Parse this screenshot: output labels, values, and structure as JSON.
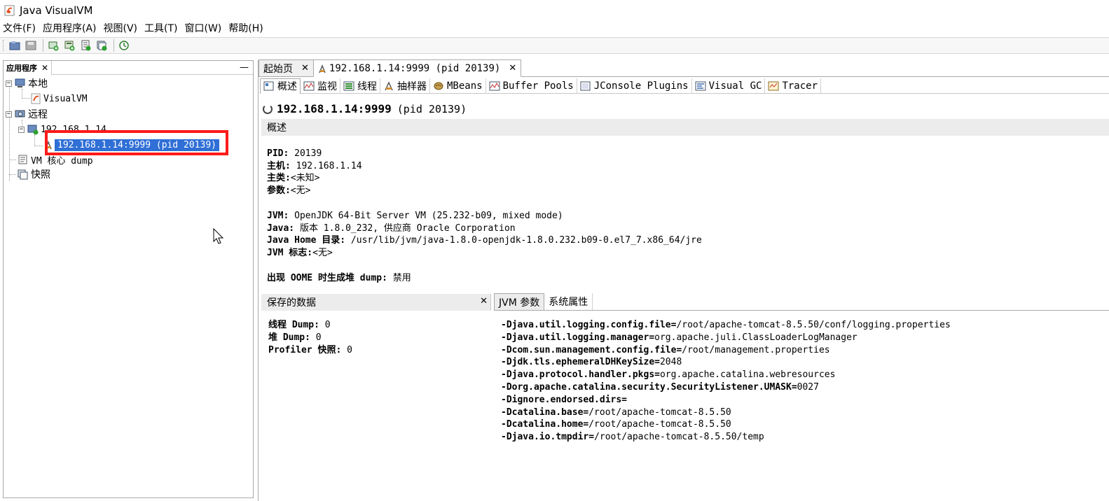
{
  "window": {
    "title": "Java VisualVM"
  },
  "menu": [
    "文件(F)",
    "应用程序(A)",
    "视图(V)",
    "工具(T)",
    "窗口(W)",
    "帮助(H)"
  ],
  "toolbar": {
    "icons": [
      "open-icon",
      "save-icon",
      "add-jmx-connection-icon",
      "add-remote-host-icon",
      "add-vm-coredump-icon",
      "add-snapshot-icon",
      "compare-icon"
    ]
  },
  "left_pane": {
    "tab_label": "应用程序",
    "tree": {
      "local": "本地",
      "visualvm": "VisualVM",
      "remote": "远程",
      "remote_host": "192.168.1.14",
      "remote_app": "192.168.1.14:9999 (pid 20139)",
      "coredump": "VM 核心 dump",
      "snapshot": "快照"
    }
  },
  "doc_tabs": [
    {
      "label": "起始页",
      "active": false
    },
    {
      "label": "192.168.1.14:9999 (pid 20139)",
      "active": true
    }
  ],
  "view_tabs": [
    {
      "label": "概述",
      "icon": "overview-icon",
      "active": true
    },
    {
      "label": "监视",
      "icon": "monitor-icon"
    },
    {
      "label": "线程",
      "icon": "threads-icon"
    },
    {
      "label": "抽样器",
      "icon": "sampler-icon"
    },
    {
      "label": "MBeans",
      "icon": "mbeans-icon"
    },
    {
      "label": "Buffer Pools",
      "icon": "buffer-pools-icon"
    },
    {
      "label": "JConsole Plugins",
      "icon": "jconsole-icon"
    },
    {
      "label": "Visual GC",
      "icon": "visual-gc-icon"
    },
    {
      "label": "Tracer",
      "icon": "tracer-icon"
    }
  ],
  "overview": {
    "host": "192.168.1.14:9999",
    "pid": "(pid 20139)",
    "section": "概述",
    "pid_label": "PID:",
    "pid_value": "20139",
    "host_label": "主机:",
    "host_value": "192.168.1.14",
    "mainclass_label": "主类:",
    "mainclass_value": "<未知>",
    "args_label": "参数:",
    "args_value": "<无>",
    "jvm_label": "JVM:",
    "jvm_value": "OpenJDK 64-Bit Server VM (25.232-b09, mixed mode)",
    "java_label": "Java:",
    "java_value": "版本 1.8.0_232, 供应商 Oracle Corporation",
    "javahome_label": "Java Home 目录:",
    "javahome_value": "/usr/lib/jvm/java-1.8.0-openjdk-1.8.0.232.b09-0.el7_7.x86_64/jre",
    "jvmflags_label": "JVM 标志:",
    "jvmflags_value": "<无>",
    "oome_label": "出现 OOME 时生成堆 dump:",
    "oome_value": "禁用"
  },
  "saved_data": {
    "title": "保存的数据",
    "thread_label": "线程 Dump:",
    "thread_value": "0",
    "heap_label": "堆 Dump:",
    "heap_value": "0",
    "profiler_label": "Profiler 快照:",
    "profiler_value": "0"
  },
  "jvm_tabs": {
    "args": "JVM 参数",
    "props": "系统属性"
  },
  "jvm_args": [
    {
      "key": "-Djava.util.logging.config.file=",
      "value": "/root/apache-tomcat-8.5.50/conf/logging.properties"
    },
    {
      "key": "-Djava.util.logging.manager=",
      "value": "org.apache.juli.ClassLoaderLogManager"
    },
    {
      "key": "-Dcom.sun.management.config.file=",
      "value": "/root/management.properties"
    },
    {
      "key": "-Djdk.tls.ephemeralDHKeySize=",
      "value": "2048"
    },
    {
      "key": "-Djava.protocol.handler.pkgs=",
      "value": "org.apache.catalina.webresources"
    },
    {
      "key": "-Dorg.apache.catalina.security.SecurityListener.UMASK=",
      "value": "0027"
    },
    {
      "key": "-Dignore.endorsed.dirs=",
      "value": ""
    },
    {
      "key": "-Dcatalina.base=",
      "value": "/root/apache-tomcat-8.5.50"
    },
    {
      "key": "-Dcatalina.home=",
      "value": "/root/apache-tomcat-8.5.50"
    },
    {
      "key": "-Djava.io.tmpdir=",
      "value": "/root/apache-tomcat-8.5.50/temp"
    }
  ]
}
